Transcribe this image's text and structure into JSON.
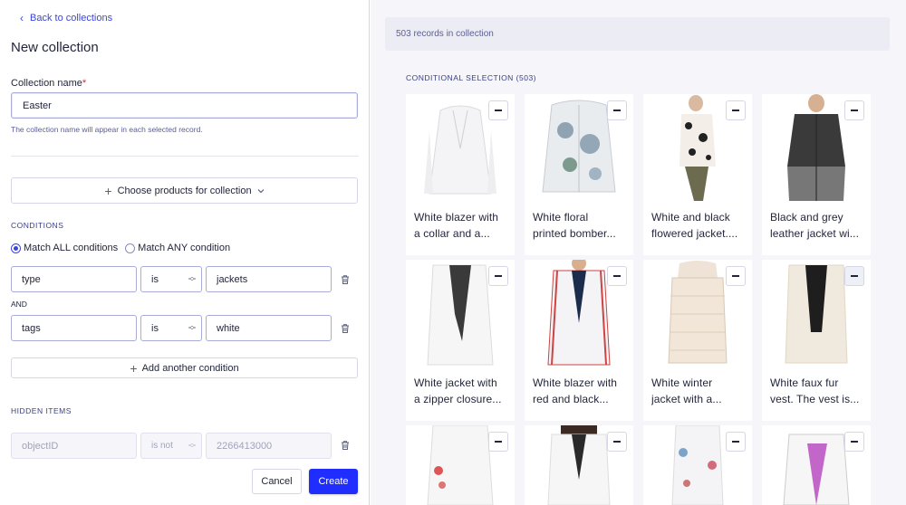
{
  "left": {
    "back_label": "Back to collections",
    "title": "New collection",
    "name_label": "Collection name",
    "required_mark": "*",
    "name_value": "Easter",
    "name_help": "The collection name will appear in each selected record.",
    "choose_label": "Choose products for collection",
    "conditions_heading": "CONDITIONS",
    "match_all": "Match ALL conditions",
    "match_any": "Match ANY condition",
    "and_label": "AND",
    "conditions": [
      {
        "field": "type",
        "operator": "is",
        "value": "jackets"
      },
      {
        "field": "tags",
        "operator": "is",
        "value": "white"
      }
    ],
    "add_condition": "Add another condition",
    "hidden_heading": "HIDDEN ITEMS",
    "hidden": {
      "field": "objectID",
      "operator": "is not",
      "value": "2266413000"
    },
    "cancel": "Cancel",
    "create": "Create"
  },
  "right": {
    "records_count": "503 records in collection",
    "cond_title": "CONDITIONAL SELECTION (503)",
    "products": [
      {
        "line1": "White blazer with",
        "line2": "a collar and a...",
        "img": "white-blazer"
      },
      {
        "line1": "White floral",
        "line2": "printed bomber...",
        "img": "floral-bomber"
      },
      {
        "line1": "White and black",
        "line2": "flowered jacket....",
        "img": "flowered-jacket"
      },
      {
        "line1": "Black and grey",
        "line2": "leather jacket wi...",
        "img": "leather-jacket"
      },
      {
        "line1": "White jacket with",
        "line2": "a zipper closure...",
        "img": "zipper-jacket"
      },
      {
        "line1": "White blazer with",
        "line2": "red and black...",
        "img": "red-trim-blazer"
      },
      {
        "line1": "White winter",
        "line2": "jacket with a...",
        "img": "winter-jacket"
      },
      {
        "line1": "White faux fur",
        "line2": "vest. The vest is...",
        "img": "fur-vest"
      },
      {
        "line1": "",
        "line2": "",
        "img": "embroidered-denim"
      },
      {
        "line1": "",
        "line2": "",
        "img": "white-blazer-2"
      },
      {
        "line1": "",
        "line2": "",
        "img": "floral-vest"
      },
      {
        "line1": "",
        "line2": "",
        "img": "biker-jacket"
      }
    ]
  },
  "colors": {
    "accent": "#1f2dff",
    "link": "#3a46d9",
    "section": "#3a4182"
  }
}
